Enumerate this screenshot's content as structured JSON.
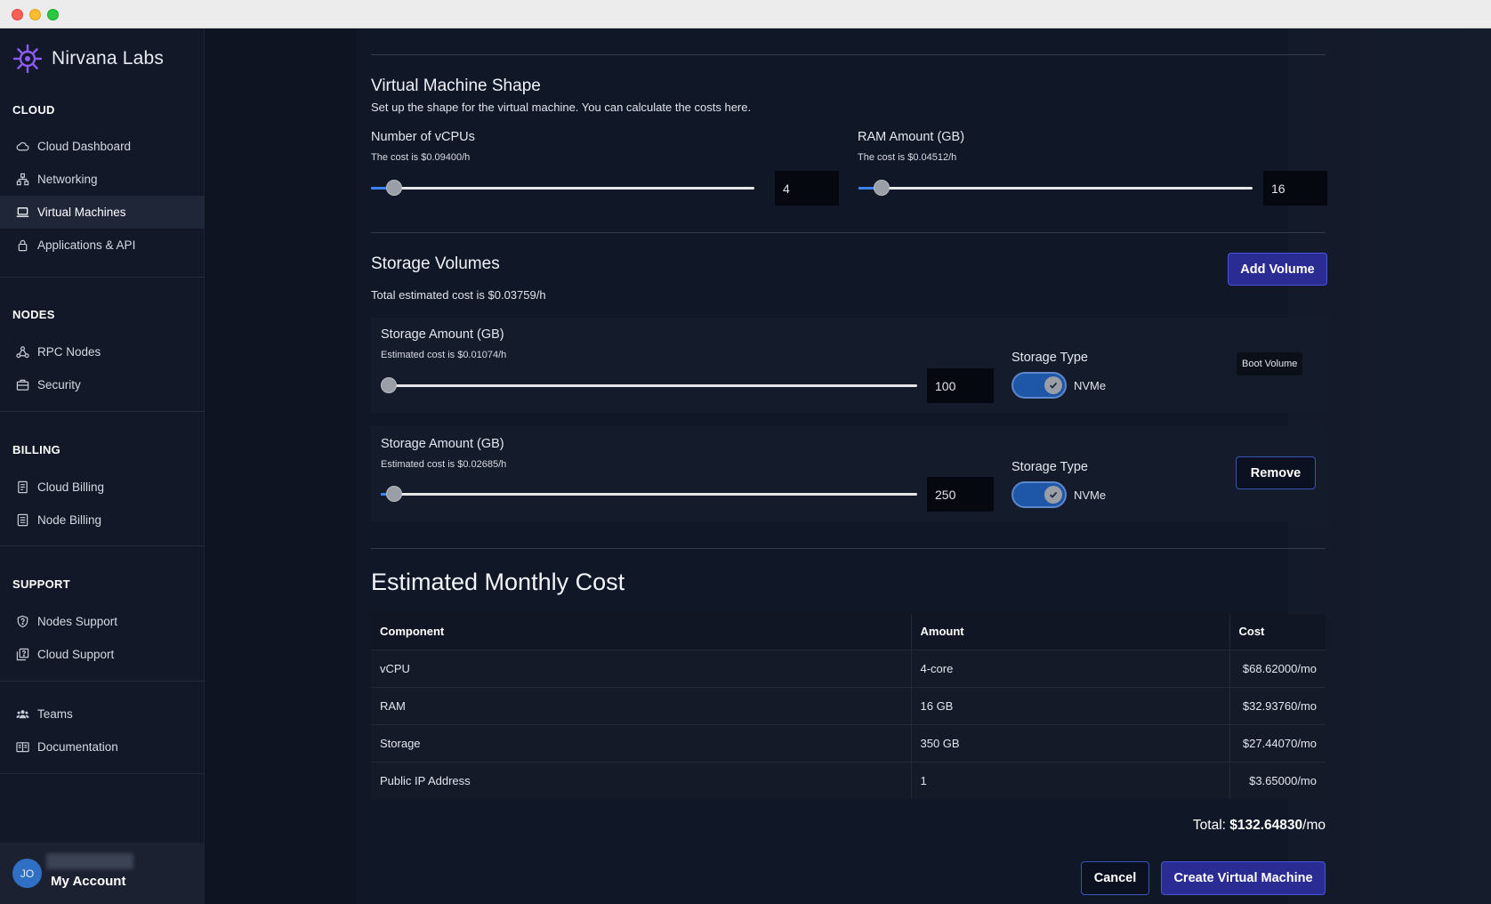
{
  "window": {
    "title": ""
  },
  "sidebar": {
    "brand": "Nirvana Labs",
    "sections": {
      "cloud": "CLOUD",
      "nodes": "NODES",
      "billing": "BILLING",
      "support": "SUPPORT"
    },
    "items": [
      {
        "label": "Cloud Dashboard",
        "icon": "cloud-icon"
      },
      {
        "label": "Networking",
        "icon": "network-icon"
      },
      {
        "label": "Virtual Machines",
        "icon": "laptop-icon",
        "active": true
      },
      {
        "label": "Applications & API",
        "icon": "lock-icon"
      },
      {
        "label": "RPC Nodes",
        "icon": "nodes-icon"
      },
      {
        "label": "Security",
        "icon": "briefcase-icon"
      },
      {
        "label": "Cloud Billing",
        "icon": "receipt-icon"
      },
      {
        "label": "Node Billing",
        "icon": "document-icon"
      },
      {
        "label": "Nodes Support",
        "icon": "help-shield-icon"
      },
      {
        "label": "Cloud Support",
        "icon": "help-copy-icon"
      },
      {
        "label": "Teams",
        "icon": "team-icon"
      },
      {
        "label": "Documentation",
        "icon": "book-icon"
      }
    ],
    "account": {
      "initials": "JO",
      "label": "My Account"
    }
  },
  "shape": {
    "title": "Virtual Machine Shape",
    "subtitle": "Set up the shape for the virtual machine. You can calculate the costs here.",
    "vcpu": {
      "label": "Number of vCPUs",
      "cost": "The cost is $0.09400/h",
      "value": "4",
      "level": 0.04
    },
    "ram": {
      "label": "RAM Amount (GB)",
      "cost": "The cost is $0.04512/h",
      "value": "16",
      "level": 0.04
    }
  },
  "storage": {
    "title": "Storage Volumes",
    "total_cost": "Total estimated cost is $0.03759/h",
    "add_button": "Add Volume",
    "volumes": [
      {
        "label": "Storage Amount (GB)",
        "cost": "Estimated cost is $0.01074/h",
        "value": "100",
        "level": 0.0,
        "type_label": "Storage Type",
        "type": "NVMe",
        "badge": "Boot Volume"
      },
      {
        "label": "Storage Amount (GB)",
        "cost": "Estimated cost is $0.02685/h",
        "value": "250",
        "level": 0.01,
        "type_label": "Storage Type",
        "type": "NVMe",
        "remove": "Remove"
      }
    ]
  },
  "monthly": {
    "title": "Estimated Monthly Cost",
    "headers": [
      "Component",
      "Amount",
      "Cost"
    ],
    "rows": [
      [
        "vCPU",
        "4-core",
        "$68.62000/mo"
      ],
      [
        "RAM",
        "16 GB",
        "$32.93760/mo"
      ],
      [
        "Storage",
        "350 GB",
        "$27.44070/mo"
      ],
      [
        "Public IP Address",
        "1",
        "$3.65000/mo"
      ]
    ],
    "total_label": "Total:",
    "total_value": "$132.64830",
    "total_unit": "/mo"
  },
  "actions": {
    "cancel": "Cancel",
    "create": "Create Virtual Machine"
  },
  "colors": {
    "accent": "#2a2b93",
    "toggle": "#1e56a8",
    "slider_fill": "#3b82f6"
  }
}
